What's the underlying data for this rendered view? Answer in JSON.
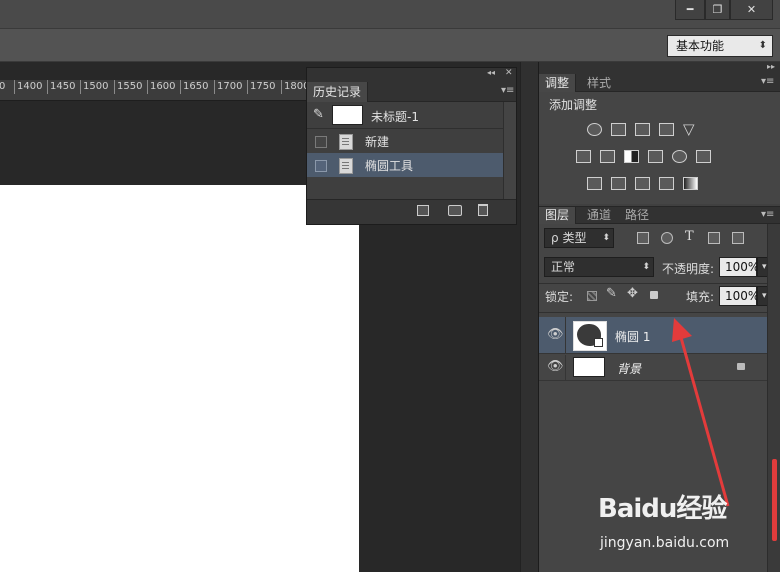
{
  "window": {
    "minimize_glyph": "━",
    "restore_glyph": "❐",
    "close_glyph": "✕"
  },
  "options_bar": {
    "workspace": "基本功能",
    "workspace_arrow": "⬍"
  },
  "ruler": {
    "ticks": [
      "1400",
      "1450",
      "1500",
      "1550",
      "1600",
      "1650",
      "1700",
      "1750",
      "1800"
    ],
    "first_partial": "0"
  },
  "history_panel": {
    "collapse_glyph": "◂◂",
    "close_glyph": "✕",
    "tab": "历史记录",
    "menu_glyph": "▾≡",
    "snapshot_label": "未标题-1",
    "items": [
      {
        "label": "新建",
        "selected": false
      },
      {
        "label": "椭圆工具",
        "selected": true
      }
    ],
    "footer_icons": [
      "new-document-from-state-icon",
      "snapshot-camera-icon",
      "trash-icon"
    ]
  },
  "adjustments_panel": {
    "tabs": [
      "调整",
      "样式"
    ],
    "title": "添加调整",
    "icon_rows": [
      [
        "brightness-contrast-icon",
        "levels-icon",
        "curves-icon",
        "exposure-icon",
        "vibrance-icon"
      ],
      [
        "hue-saturation-icon",
        "color-balance-icon",
        "black-white-icon",
        "photo-filter-icon",
        "channel-mixer-icon",
        "color-lookup-icon"
      ],
      [
        "invert-icon",
        "posterize-icon",
        "threshold-icon",
        "selective-color-icon",
        "gradient-map-icon"
      ]
    ]
  },
  "layers_panel": {
    "tabs": [
      "图层",
      "通道",
      "路径"
    ],
    "filter_label": "类型",
    "filter_prefix": "ρ",
    "blend_mode": "正常",
    "opacity_label": "不透明度:",
    "opacity_value": "100%",
    "lock_label": "锁定:",
    "fill_label": "填充:",
    "fill_value": "100%",
    "layers": [
      {
        "name": "椭圆 1",
        "selected": true,
        "eye": "👁"
      },
      {
        "name": "背景",
        "selected": false,
        "eye": "👁",
        "locked": true
      }
    ]
  },
  "watermark": {
    "brand": "Baidu经验",
    "url": "jingyan.baidu.com"
  },
  "colors": {
    "accent_selected": "#4d5b6d",
    "canvas": "#ffffff",
    "arrow": "#e33b3b"
  }
}
